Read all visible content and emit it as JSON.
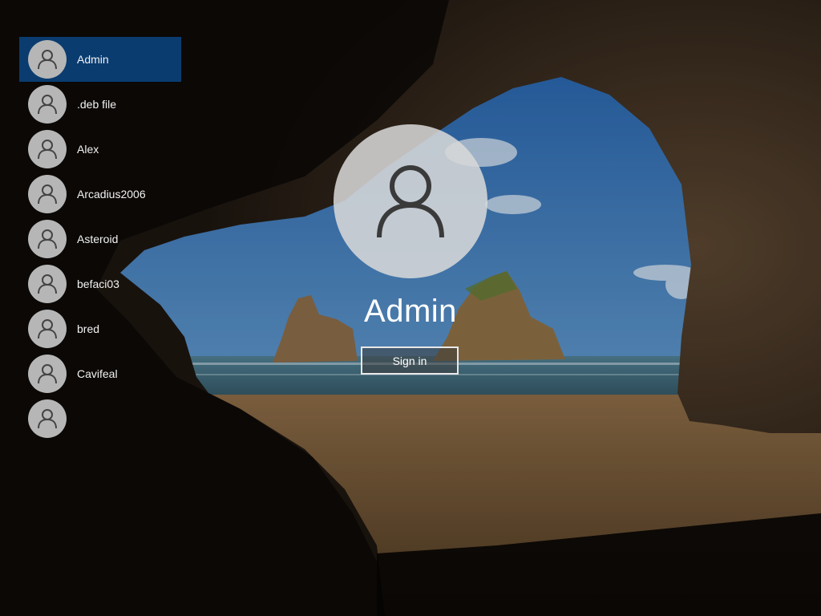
{
  "wallpaper": {
    "icon": "cave-beach-wallpaper",
    "colors": {
      "sky": "#2f6fb3",
      "sea": "#3a6e86",
      "sand": "#7a5a36",
      "rock": "#2a1f16",
      "shadow": "#060504"
    }
  },
  "users": [
    {
      "name": "Admin",
      "selected": true,
      "icon": "user-icon"
    },
    {
      "name": ".deb file",
      "selected": false,
      "icon": "user-icon"
    },
    {
      "name": "Alex",
      "selected": false,
      "icon": "user-icon"
    },
    {
      "name": "Arcadius2006",
      "selected": false,
      "icon": "user-icon"
    },
    {
      "name": "Asteroid",
      "selected": false,
      "icon": "user-icon"
    },
    {
      "name": "befaci03",
      "selected": false,
      "icon": "user-icon"
    },
    {
      "name": "bred",
      "selected": false,
      "icon": "user-icon"
    },
    {
      "name": "Cavifeal",
      "selected": false,
      "icon": "user-icon"
    },
    {
      "name": "",
      "selected": false,
      "icon": "user-icon"
    }
  ],
  "login": {
    "account_name": "Admin",
    "avatar_icon": "user-icon",
    "sign_in_label": "Sign in"
  },
  "colors": {
    "selection": "#0a3c70",
    "avatar_bg": "#b6b6b6",
    "text": "#ffffff"
  }
}
